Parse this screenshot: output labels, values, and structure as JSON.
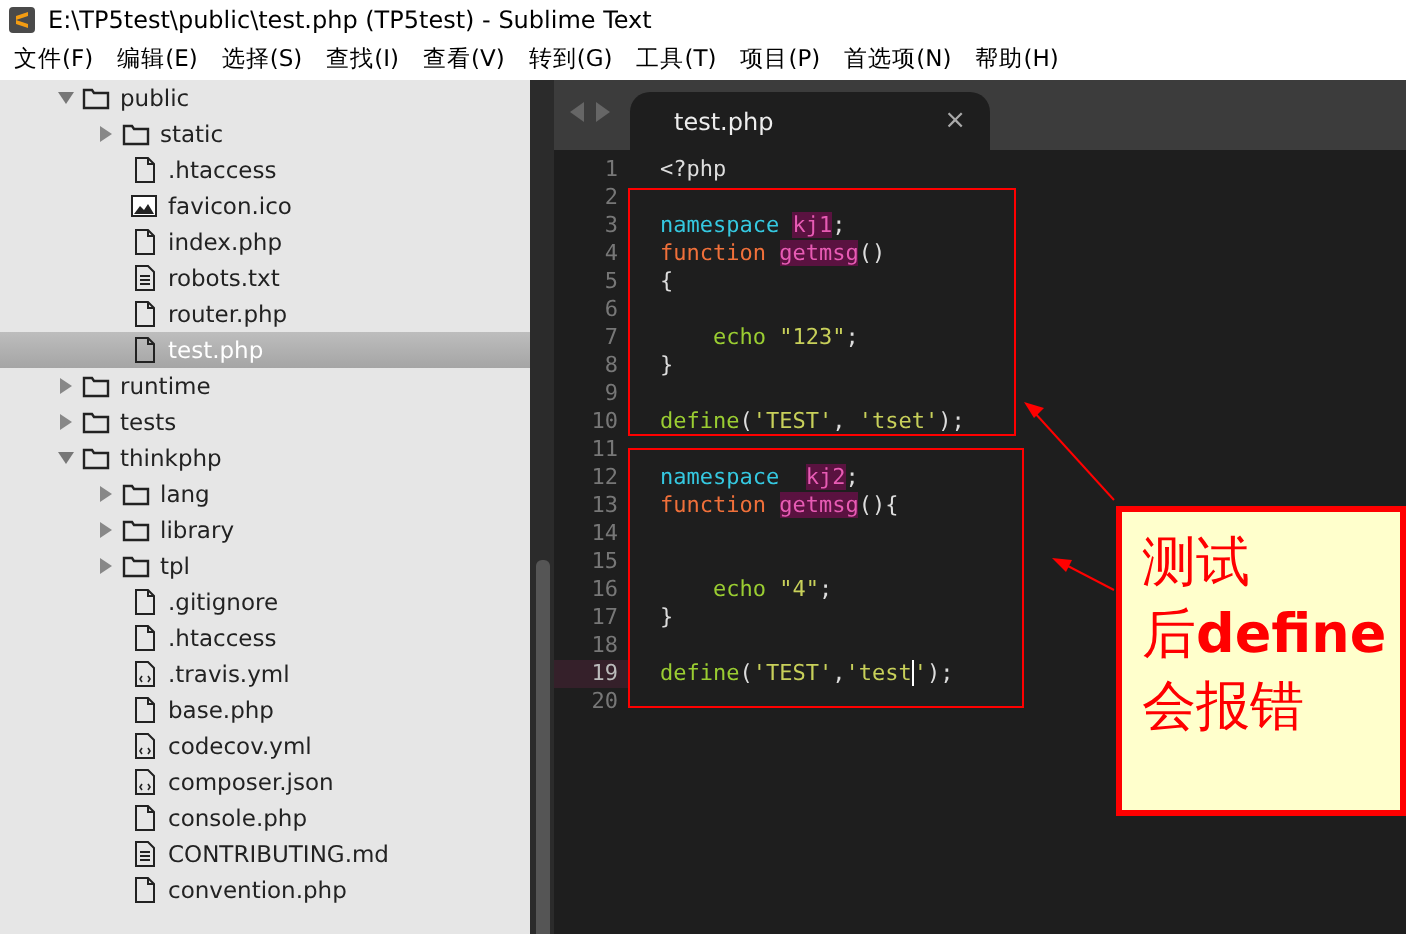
{
  "window": {
    "title": "E:\\TP5test\\public\\test.php (TP5test) - Sublime Text"
  },
  "menu": [
    "文件(F)",
    "编辑(E)",
    "选择(S)",
    "查找(I)",
    "查看(V)",
    "转到(G)",
    "工具(T)",
    "项目(P)",
    "首选项(N)",
    "帮助(H)"
  ],
  "sidebar": {
    "items": [
      {
        "label": "public",
        "kind": "folder",
        "expanded": true,
        "selected": false,
        "children": [
          {
            "label": "static",
            "kind": "folder",
            "expanded": false,
            "selected": false
          },
          {
            "label": ".htaccess",
            "kind": "file",
            "selected": false
          },
          {
            "label": "favicon.ico",
            "kind": "image",
            "selected": false
          },
          {
            "label": "index.php",
            "kind": "file",
            "selected": false
          },
          {
            "label": "robots.txt",
            "kind": "text",
            "selected": false
          },
          {
            "label": "router.php",
            "kind": "file",
            "selected": false
          },
          {
            "label": "test.php",
            "kind": "file",
            "selected": true
          }
        ]
      },
      {
        "label": "runtime",
        "kind": "folder",
        "expanded": false,
        "selected": false
      },
      {
        "label": "tests",
        "kind": "folder",
        "expanded": false,
        "selected": false
      },
      {
        "label": "thinkphp",
        "kind": "folder",
        "expanded": true,
        "selected": false,
        "children": [
          {
            "label": "lang",
            "kind": "folder",
            "expanded": false,
            "selected": false
          },
          {
            "label": "library",
            "kind": "folder",
            "expanded": false,
            "selected": false
          },
          {
            "label": "tpl",
            "kind": "folder",
            "expanded": false,
            "selected": false
          },
          {
            "label": ".gitignore",
            "kind": "file",
            "selected": false
          },
          {
            "label": ".htaccess",
            "kind": "file",
            "selected": false
          },
          {
            "label": ".travis.yml",
            "kind": "code",
            "selected": false
          },
          {
            "label": "base.php",
            "kind": "file",
            "selected": false
          },
          {
            "label": "codecov.yml",
            "kind": "code",
            "selected": false
          },
          {
            "label": "composer.json",
            "kind": "code",
            "selected": false
          },
          {
            "label": "console.php",
            "kind": "file",
            "selected": false
          },
          {
            "label": "CONTRIBUTING.md",
            "kind": "text",
            "selected": false
          },
          {
            "label": "convention.php",
            "kind": "file",
            "selected": false
          }
        ]
      }
    ]
  },
  "tabs": [
    {
      "label": "test.php",
      "selected": true,
      "close": "×"
    }
  ],
  "editor": {
    "lines": [
      {
        "number": "1",
        "current": false,
        "tokens": [
          {
            "text": "<?php",
            "kind": "plain"
          }
        ]
      },
      {
        "number": "2",
        "current": false
      },
      {
        "number": "3",
        "current": false,
        "tokens": [
          {
            "text": "namespace ",
            "kind": "keyword"
          },
          {
            "text": "kj1",
            "kind": "entity"
          },
          {
            "text": ";",
            "kind": "plain"
          }
        ]
      },
      {
        "number": "4",
        "current": false,
        "tokens": [
          {
            "text": "function ",
            "kind": "storage"
          },
          {
            "text": "getmsg",
            "kind": "entity"
          },
          {
            "text": "()",
            "kind": "plain"
          }
        ]
      },
      {
        "number": "5",
        "current": false,
        "tokens": [
          {
            "text": "{",
            "kind": "plain"
          }
        ]
      },
      {
        "number": "6",
        "current": false
      },
      {
        "number": "7",
        "current": false,
        "tokens": [
          {
            "text": "    echo ",
            "kind": "support"
          },
          {
            "text": "\"123\"",
            "kind": "string"
          },
          {
            "text": ";",
            "kind": "plain"
          }
        ]
      },
      {
        "number": "8",
        "current": false,
        "tokens": [
          {
            "text": "}",
            "kind": "plain"
          }
        ]
      },
      {
        "number": "9",
        "current": false
      },
      {
        "number": "10",
        "current": false,
        "tokens": [
          {
            "text": "define",
            "kind": "support"
          },
          {
            "text": "(",
            "kind": "plain"
          },
          {
            "text": "'TEST'",
            "kind": "string"
          },
          {
            "text": ", ",
            "kind": "plain"
          },
          {
            "text": "'tset'",
            "kind": "string"
          },
          {
            "text": ");",
            "kind": "plain"
          }
        ]
      },
      {
        "number": "11",
        "current": false
      },
      {
        "number": "12",
        "current": false,
        "tokens": [
          {
            "text": "namespace  ",
            "kind": "keyword"
          },
          {
            "text": "kj2",
            "kind": "entity"
          },
          {
            "text": ";",
            "kind": "plain"
          }
        ]
      },
      {
        "number": "13",
        "current": false,
        "tokens": [
          {
            "text": "function ",
            "kind": "storage"
          },
          {
            "text": "getmsg",
            "kind": "entity"
          },
          {
            "text": "(){",
            "kind": "plain"
          }
        ]
      },
      {
        "number": "14",
        "current": false
      },
      {
        "number": "15",
        "current": false
      },
      {
        "number": "16",
        "current": false,
        "tokens": [
          {
            "text": "    echo ",
            "kind": "support"
          },
          {
            "text": "\"4\"",
            "kind": "string"
          },
          {
            "text": ";",
            "kind": "plain"
          }
        ]
      },
      {
        "number": "17",
        "current": false,
        "tokens": [
          {
            "text": "}",
            "kind": "plain"
          }
        ]
      },
      {
        "number": "18",
        "current": false
      },
      {
        "number": "19",
        "current": true,
        "tokens": [
          {
            "text": "define",
            "kind": "support"
          },
          {
            "text": "(",
            "kind": "plain"
          },
          {
            "text": "'TEST'",
            "kind": "string"
          },
          {
            "text": ",",
            "kind": "plain"
          },
          {
            "text": "'test",
            "kind": "string",
            "cursor": true
          },
          {
            "text": "'",
            "kind": "string"
          },
          {
            "text": ");",
            "kind": "plain"
          }
        ]
      },
      {
        "number": "20",
        "current": false
      }
    ]
  },
  "callout": {
    "lines": [
      "测试",
      "后**define**",
      "会报错"
    ]
  }
}
